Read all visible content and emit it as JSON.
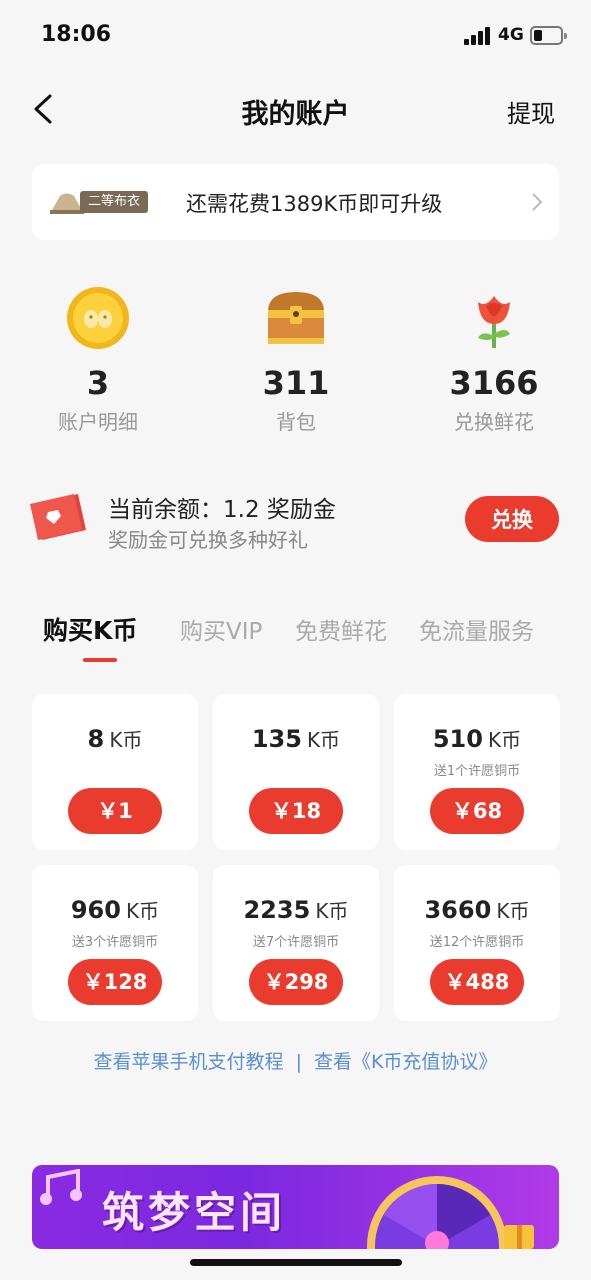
{
  "status": {
    "time": "18:06",
    "network": "4G"
  },
  "nav": {
    "title": "我的账户",
    "withdraw": "提现"
  },
  "level": {
    "badge": "二等布衣",
    "message": "还需花费1389K币即可升级"
  },
  "stats": [
    {
      "value": "3",
      "label": "账户明细",
      "icon": "coin-icon"
    },
    {
      "value": "311",
      "label": "背包",
      "icon": "treasure-chest-icon"
    },
    {
      "value": "3166",
      "label": "兑换鲜花",
      "icon": "flower-icon"
    }
  ],
  "reward": {
    "title": "当前余额：1.2 奖励金",
    "subtitle": "奖励金可兑换多种好礼",
    "button": "兑换"
  },
  "tabs": [
    "购买K币",
    "购买VIP",
    "免费鲜花",
    "免流量服务"
  ],
  "active_tab": 0,
  "packages": [
    {
      "amount": "8",
      "unit": "K币",
      "bonus": "",
      "price": "￥1"
    },
    {
      "amount": "135",
      "unit": "K币",
      "bonus": "",
      "price": "￥18"
    },
    {
      "amount": "510",
      "unit": "K币",
      "bonus": "送1个许愿铜币",
      "price": "￥68"
    },
    {
      "amount": "960",
      "unit": "K币",
      "bonus": "送3个许愿铜币",
      "price": "￥128"
    },
    {
      "amount": "2235",
      "unit": "K币",
      "bonus": "送7个许愿铜币",
      "price": "￥298"
    },
    {
      "amount": "3660",
      "unit": "K币",
      "bonus": "送12个许愿铜币",
      "price": "￥488"
    }
  ],
  "links": {
    "tutorial": "查看苹果手机支付教程",
    "separator": "|",
    "agreement": "查看《K币充值协议》"
  },
  "banner": {
    "text": "筑梦空间"
  },
  "colors": {
    "accent": "#e93c2f",
    "link": "#5b8fd1",
    "background": "#f6f6f6"
  }
}
